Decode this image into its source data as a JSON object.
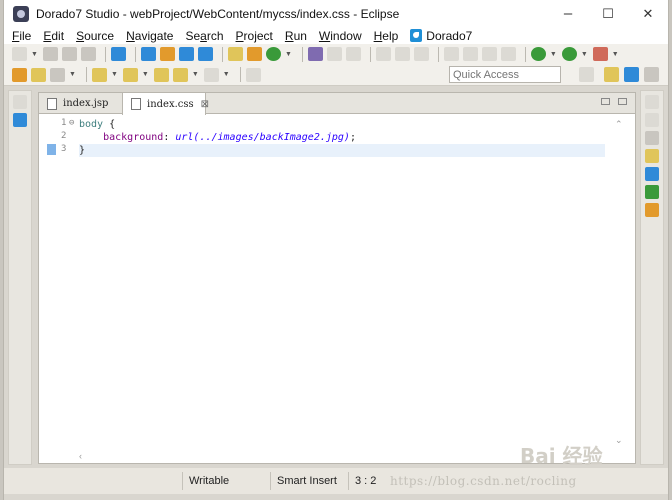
{
  "window": {
    "title": "Dorado7 Studio - webProject/WebContent/mycss/index.css - Eclipse",
    "minimize": "–",
    "maximize": "☐",
    "close": "✕"
  },
  "menu": {
    "items": [
      {
        "label": "File",
        "accel": "F",
        "rest": "ile"
      },
      {
        "label": "Edit",
        "accel": "E",
        "rest": "dit"
      },
      {
        "label": "Source",
        "accel": "S",
        "rest": "ource"
      },
      {
        "label": "Navigate",
        "accel": "N",
        "rest": "avigate"
      },
      {
        "label": "Search",
        "accel": "a",
        "pre": "Se",
        "rest": "rch"
      },
      {
        "label": "Project",
        "accel": "P",
        "rest": "roject"
      },
      {
        "label": "Run",
        "accel": "R",
        "rest": "un"
      },
      {
        "label": "Window",
        "accel": "W",
        "rest": "indow"
      },
      {
        "label": "Help",
        "accel": "H",
        "rest": "elp"
      }
    ],
    "dorado": "Dorado7"
  },
  "toolbar": {
    "quick_access_placeholder": "Quick Access"
  },
  "editor": {
    "tabs": [
      {
        "label": "index.jsp",
        "active": false
      },
      {
        "label": "index.css",
        "active": true,
        "close": "⊠"
      }
    ],
    "line_numbers": [
      "1",
      "2",
      "3"
    ],
    "fold_marker": "⊖",
    "code": {
      "l1_selector": "body",
      "l1_brace": " {",
      "l2_indent": "    ",
      "l2_property": "background",
      "l2_colon": ": ",
      "l2_value": "url(../images/backImage2.jpg)",
      "l2_semicolon": ";",
      "l3_brace": "}"
    }
  },
  "statusbar": {
    "writable": "Writable",
    "insert_mode": "Smart Insert",
    "position": "3 : 2"
  },
  "watermark": {
    "url": "https://blog.csdn.net/rocling",
    "baidu": "Bai 经验"
  }
}
